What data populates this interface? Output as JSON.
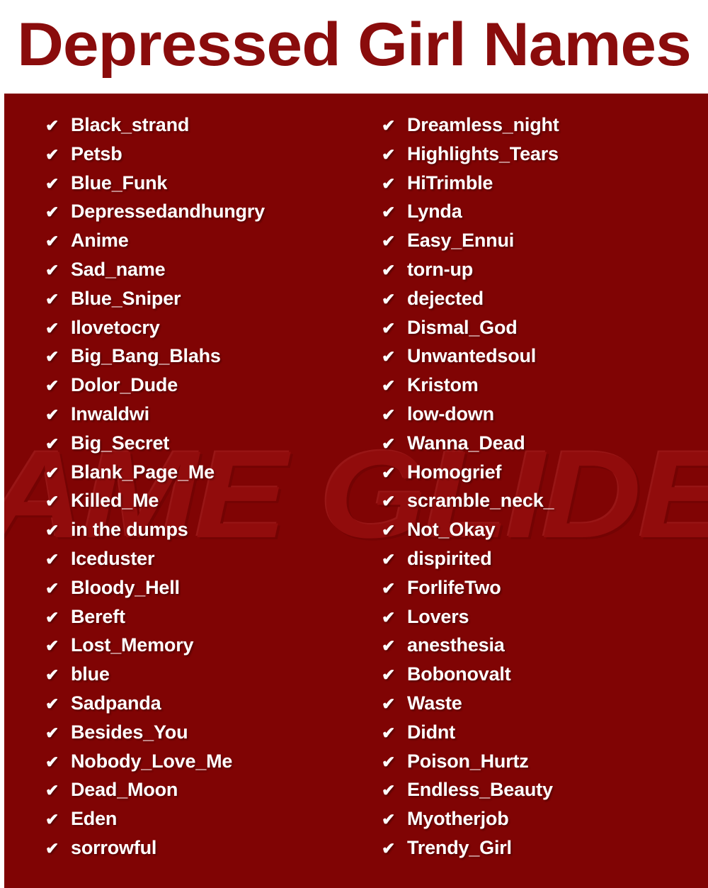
{
  "header": {
    "title": "Depressed Girl Names"
  },
  "watermark": {
    "text": "NAME GLIDER"
  },
  "colors": {
    "panel_red": "#800404",
    "title_red": "#8a0c0c",
    "text_white": "#ffffff",
    "watermark_red": "#9c1111"
  },
  "icons": {
    "check": "✔"
  },
  "list": {
    "left_column": [
      "Black_strand",
      "Petsb",
      "Blue_Funk",
      "Depressedandhungry",
      "Anime",
      "Sad_name",
      "Blue_Sniper",
      "Ilovetocry",
      "Big_Bang_Blahs",
      "Dolor_Dude",
      "Inwaldwi",
      "Big_Secret",
      "Blank_Page_Me",
      "Killed_Me",
      "in the dumps",
      "Iceduster",
      "Bloody_Hell",
      "Bereft",
      "Lost_Memory",
      "blue",
      "Sadpanda",
      "Besides_You",
      "Nobody_Love_Me",
      "Dead_Moon",
      "Eden",
      "sorrowful"
    ],
    "right_column": [
      "Dreamless_night",
      "Highlights_Tears",
      "HiTrimble",
      "Lynda",
      "Easy_Ennui",
      "torn-up",
      "dejected",
      "Dismal_God",
      "Unwantedsoul",
      "Kristom",
      "low-down",
      "Wanna_Dead",
      "Homogrief",
      "scramble_neck_",
      "Not_Okay",
      "dispirited",
      "ForlifeTwo",
      "Lovers",
      "anesthesia",
      "Bobonovalt",
      "Waste",
      "Didnt",
      "Poison_Hurtz",
      "Endless_Beauty",
      "Myotherjob",
      "Trendy_Girl"
    ]
  }
}
